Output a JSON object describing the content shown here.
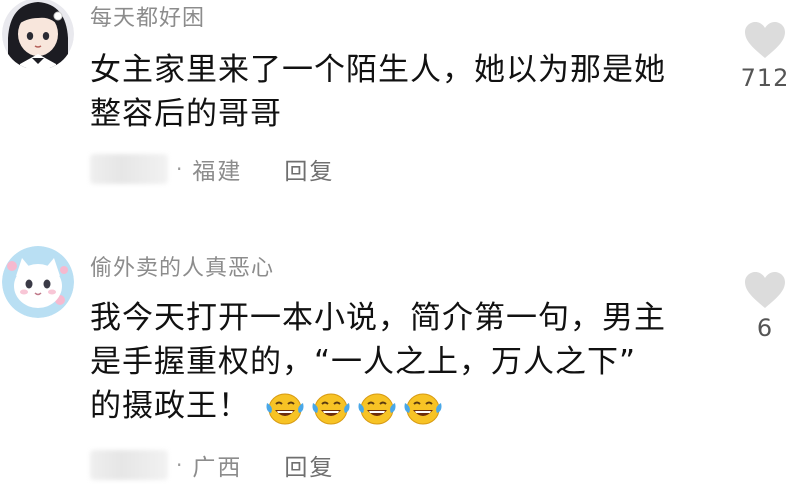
{
  "comments": [
    {
      "username": "每天都好困",
      "text_lines": [
        "女主家里来了一个陌生人，她以为那是她",
        "整容后的哥哥"
      ],
      "region": "福建",
      "reply_label": "回复",
      "like_count": "712"
    },
    {
      "username": "偷外卖的人真恶心",
      "text_lines": [
        "我今天打开一本小说，简介第一句，男主",
        "是手握重权的，“一人之上，万人之下”",
        "的摄政王！"
      ],
      "emoji_icon": "laughing-tears-emoji",
      "region": "广西",
      "reply_label": "回复",
      "like_count": "6"
    }
  ],
  "colors": {
    "username": "#8c8c8c",
    "text": "#111111",
    "like_icon": "#dcdcdc",
    "emoji_face": "#f7c325",
    "emoji_tear": "#4aa8e8"
  }
}
